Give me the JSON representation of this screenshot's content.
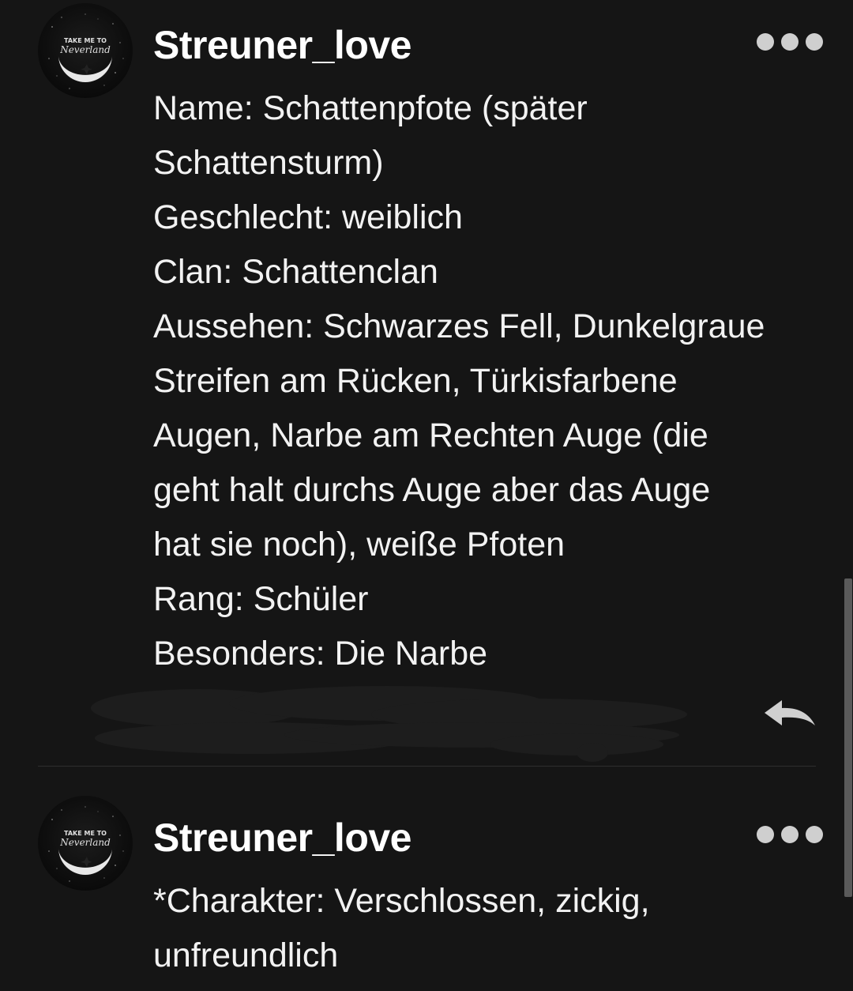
{
  "comments": [
    {
      "username": "Streuner_love",
      "avatar": {
        "icon": "moon-avatar-icon",
        "text_top": "TAKE ME TO",
        "text_script": "Neverland"
      },
      "lines": [
        "Name: Schattenpfote (später",
        "Schattensturm)",
        "Geschlecht: weiblich",
        "Clan: Schattenclan",
        "Aussehen: Schwarzes Fell, Dunkelgraue",
        "Streifen am Rücken, Türkisfarbene",
        "Augen, Narbe am Rechten Auge (die",
        "geht halt durchs Auge aber das Auge",
        "hat sie noch), weiße Pfoten",
        "Rang: Schüler",
        "Besonders: Die Narbe"
      ],
      "more_icon": "more-dots-icon",
      "reply_icon": "reply-arrow-icon"
    },
    {
      "username": "Streuner_love",
      "avatar": {
        "icon": "moon-avatar-icon",
        "text_top": "TAKE ME TO",
        "text_script": "Neverland"
      },
      "lines": [
        "*Charakter: Verschlossen, zickig,",
        "unfreundlich"
      ],
      "more_icon": "more-dots-icon"
    }
  ],
  "colors": {
    "background": "#151515",
    "text": "#f2f2f2",
    "icon": "#cfcfcf",
    "divider": "#2e2e2e",
    "redaction": "#1d1d1d"
  }
}
